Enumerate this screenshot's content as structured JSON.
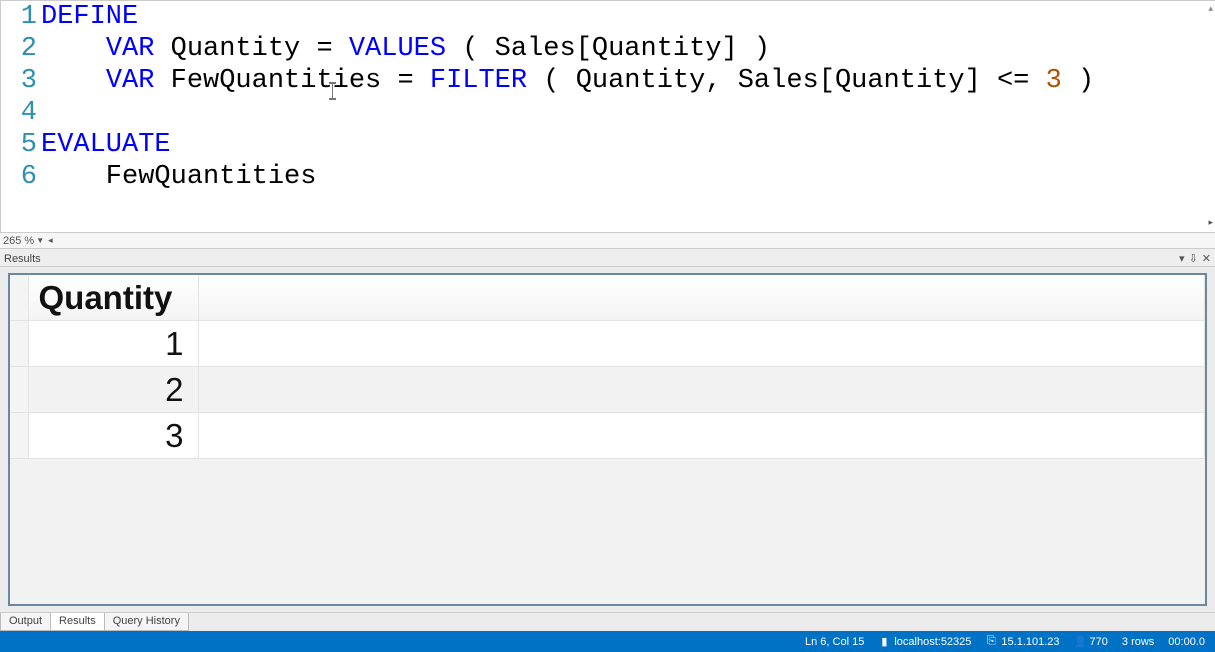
{
  "editor": {
    "zoom": "265 %",
    "lines": [
      {
        "n": 1,
        "tokens": [
          {
            "t": "DEFINE",
            "c": "kw"
          }
        ]
      },
      {
        "n": 2,
        "tokens": [
          {
            "t": "    ",
            "c": ""
          },
          {
            "t": "VAR",
            "c": "kw"
          },
          {
            "t": " Quantity = ",
            "c": "ref"
          },
          {
            "t": "VALUES",
            "c": "kw"
          },
          {
            "t": " ( Sales[Quantity] )",
            "c": "ref"
          }
        ]
      },
      {
        "n": 3,
        "tokens": [
          {
            "t": "    ",
            "c": ""
          },
          {
            "t": "VAR",
            "c": "kw"
          },
          {
            "t": " FewQuantities = ",
            "c": "ref"
          },
          {
            "t": "FILTER",
            "c": "kw"
          },
          {
            "t": " ( Quantity, Sales[Quantity] <= ",
            "c": "ref"
          },
          {
            "t": "3",
            "c": "num"
          },
          {
            "t": " )",
            "c": "ref"
          }
        ]
      },
      {
        "n": 4,
        "tokens": []
      },
      {
        "n": 5,
        "tokens": [
          {
            "t": "EVALUATE",
            "c": "kw"
          }
        ]
      },
      {
        "n": 6,
        "tokens": [
          {
            "t": "    FewQuantities",
            "c": "ref"
          }
        ]
      }
    ]
  },
  "results": {
    "panel_label": "Results",
    "column_header": "Quantity",
    "rows": [
      "1",
      "2",
      "3"
    ]
  },
  "tabs": {
    "items": [
      {
        "label": "Output",
        "active": false
      },
      {
        "label": "Results",
        "active": true
      },
      {
        "label": "Query History",
        "active": false
      }
    ]
  },
  "status": {
    "cursor": "Ln 6, Col 15",
    "server": "localhost:52325",
    "version": "15.1.101.23",
    "user": "770",
    "rows": "3 rows",
    "time": "00:00.0"
  }
}
